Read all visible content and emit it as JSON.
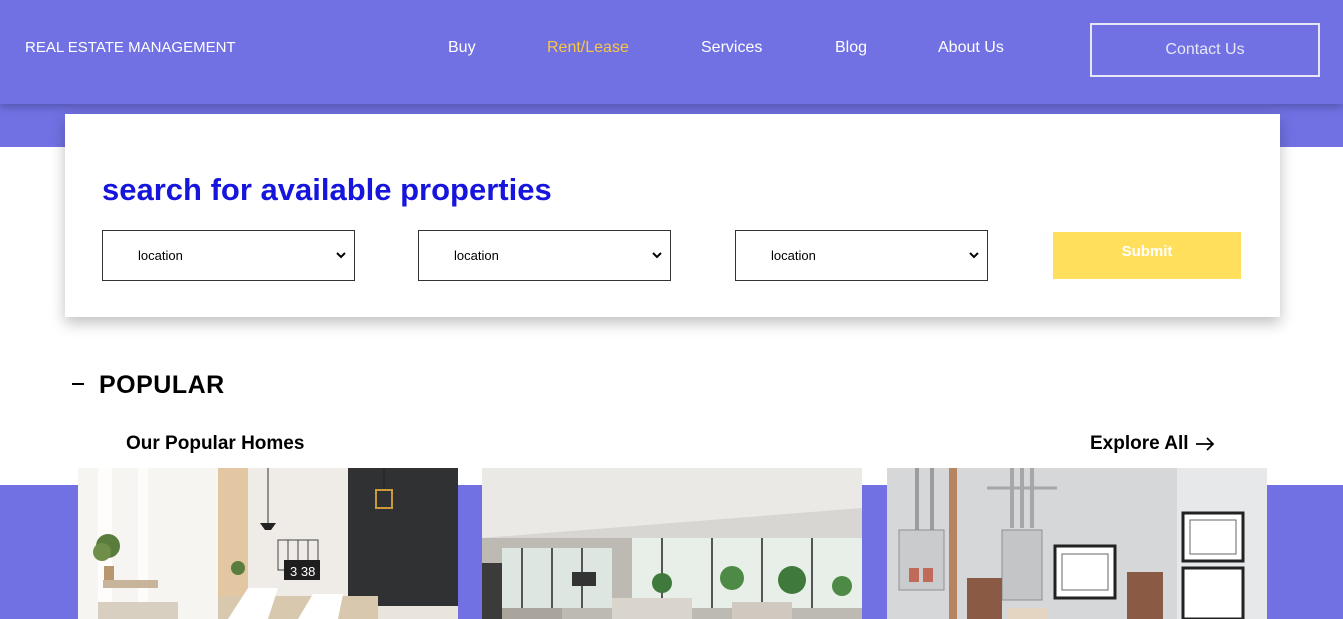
{
  "header": {
    "brand": "REAL ESTATE MANAGEMENT",
    "nav": [
      "Buy",
      "Rent/Lease",
      "Services",
      "Blog",
      "About Us"
    ],
    "active_nav": "Rent/Lease",
    "contact_label": "Contact Us"
  },
  "search": {
    "title": "search for available properties",
    "selects": [
      "location",
      "location",
      "location"
    ],
    "submit_label": "Submit"
  },
  "popular": {
    "section_title": "POPULAR",
    "subtitle": "Our Popular Homes",
    "explore_label": "Explore All",
    "cards": [
      {
        "name": "home-image-1"
      },
      {
        "name": "home-image-2"
      },
      {
        "name": "home-image-3"
      }
    ]
  },
  "colors": {
    "primary": "#7171e4",
    "accent": "#f7c744",
    "title_blue": "#1515dd",
    "submit_yellow": "#ffdf5c"
  },
  "icons": {
    "select_arrow": "chevron-down-icon",
    "explore_arrow": "arrow-right-icon",
    "popular_dash": "dash-icon"
  },
  "image_text": {
    "clock_digits": "3 38"
  }
}
